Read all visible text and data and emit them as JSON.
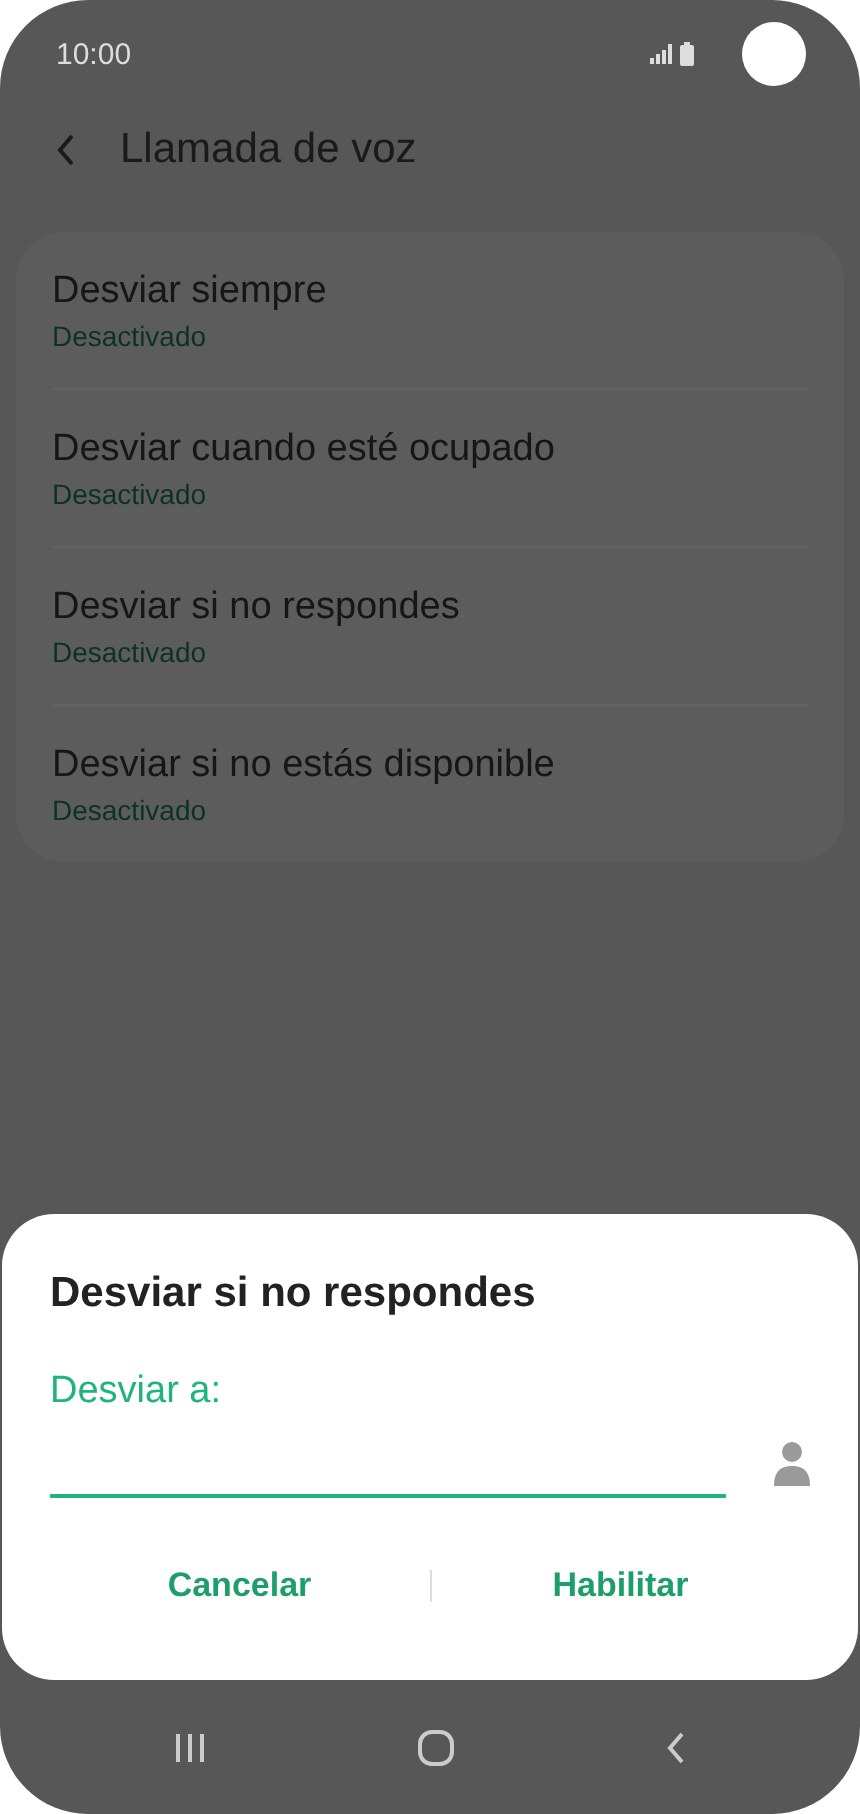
{
  "status_bar": {
    "time": "10:00"
  },
  "header": {
    "title": "Llamada de voz"
  },
  "settings": [
    {
      "title": "Desviar siempre",
      "subtitle": "Desactivado"
    },
    {
      "title": "Desviar cuando esté ocupado",
      "subtitle": "Desactivado"
    },
    {
      "title": "Desviar si no respondes",
      "subtitle": "Desactivado"
    },
    {
      "title": "Desviar si no estás disponible",
      "subtitle": "Desactivado"
    }
  ],
  "dialog": {
    "title": "Desviar si no respondes",
    "field_label": "Desviar a:",
    "buttons": [
      "Cancelar",
      "Habilitar"
    ]
  }
}
